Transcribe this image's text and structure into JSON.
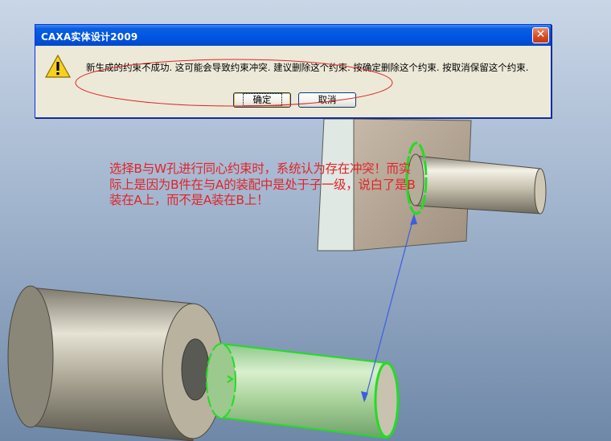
{
  "dialog": {
    "title": "CAXA实体设计2009",
    "close_glyph": "✕",
    "message": "新生成的约束不成功. 这可能会导致约束冲突. 建议删除这个约束. 按确定删除这个约束. 按取消保留这个约束.",
    "ok_label": "确定",
    "cancel_label": "取消",
    "icon": "warning-icon"
  },
  "annotation": {
    "text": "选择B与W孔进行同心约束时，系统认为存在冲突！而实际上是因为B件在与A的装配中是处于子一级，说白了是B装在A上，而不是A装在B上！"
  },
  "colors": {
    "annotation_text": "#e0242a",
    "selection_highlight": "#22dd22",
    "constraint_arrow": "#3b5fe0",
    "dialog_title_bar": "#0054e3"
  }
}
